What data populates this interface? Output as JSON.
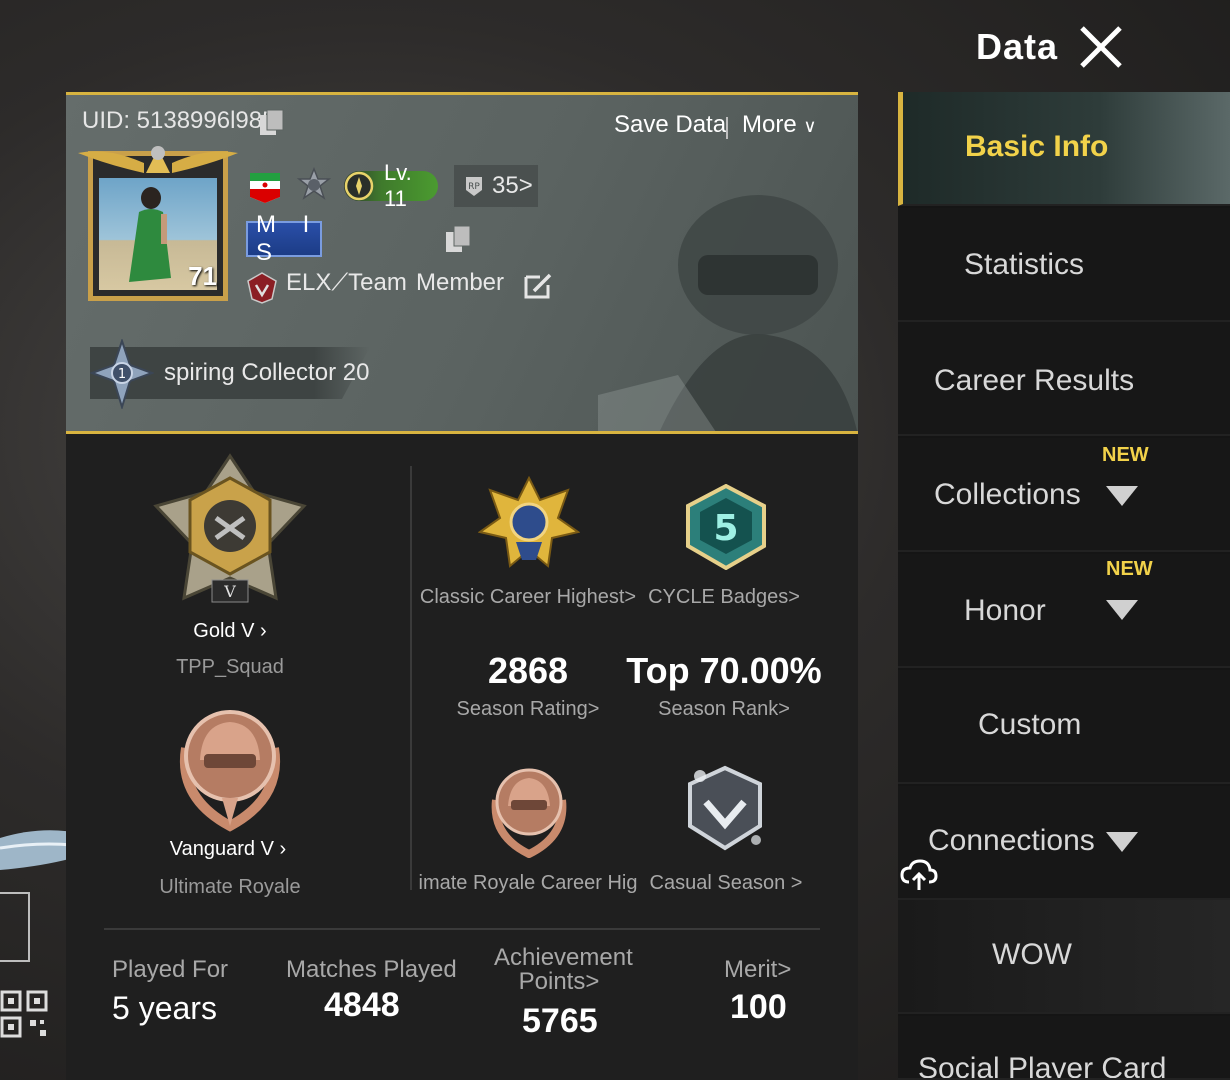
{
  "header": {
    "title": "Data"
  },
  "profile": {
    "uid": "UID: 5138996l985",
    "save_data": "Save Data",
    "more": "More",
    "avatar_level": "71",
    "level": "Lv. 11",
    "rp": "35>",
    "clan_tag": "M I S",
    "clan_name": "ELX⟋Team",
    "clan_role": "Member",
    "title": "spiring Collector 20"
  },
  "stats": {
    "tpp_tier": "Gold V",
    "tpp_mode": "TPP_Squad",
    "ur_tier": "Vanguard V",
    "ur_mode": "Ultimate Royale",
    "classic_career": "Classic Career Highest>",
    "cycle_badges": "CYCLE Badges>",
    "season_rating_value": "2868",
    "season_rating_label": "Season Rating>",
    "season_rank_value": "Top 70.00%",
    "season_rank_label": "Season Rank>",
    "ur_career": "imate Royale Career Hig",
    "casual_season": "Casual Season >",
    "cycle_number": "5"
  },
  "summary": {
    "played_for_label": "Played For",
    "played_for_value": "5 years",
    "matches_label": "Matches Played",
    "matches_value": "4848",
    "achievement_label_1": "Achievement",
    "achievement_label_2": "Points>",
    "achievement_value": "5765",
    "merit_label": "Merit>",
    "merit_value": "100"
  },
  "nav": {
    "items": [
      {
        "label": "Basic Info"
      },
      {
        "label": "Statistics"
      },
      {
        "label": "Career Results"
      },
      {
        "label": "Collections",
        "tag": "NEW"
      },
      {
        "label": "Honor",
        "tag": "NEW"
      },
      {
        "label": "Custom"
      },
      {
        "label": "Connections"
      },
      {
        "label": "WOW"
      },
      {
        "label": "Social Player Card"
      }
    ]
  },
  "colors": {
    "accent_gold": "#d8b440",
    "nav_active_text": "#f2d24a",
    "level_green": "#4b9b30"
  }
}
